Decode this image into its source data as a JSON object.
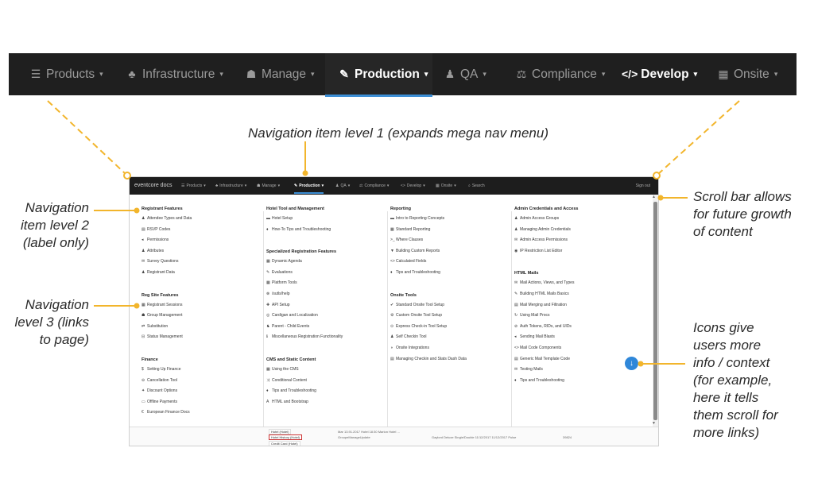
{
  "top_nav": {
    "items": [
      {
        "label": "Products",
        "icon": "list-icon",
        "glyph": "☰"
      },
      {
        "label": "Infrastructure",
        "icon": "sitemap-icon",
        "glyph": "♣"
      },
      {
        "label": "Manage",
        "icon": "users-icon",
        "glyph": "☗"
      },
      {
        "label": "Production",
        "icon": "edit-icon",
        "glyph": "✎"
      },
      {
        "label": "QA",
        "icon": "user-md-icon",
        "glyph": "♟"
      },
      {
        "label": "Compliance",
        "icon": "gavel-icon",
        "glyph": "⚖"
      },
      {
        "label": "Develop",
        "icon": "code-icon",
        "glyph": "</>"
      },
      {
        "label": "Onsite",
        "icon": "building-icon",
        "glyph": "▦"
      }
    ],
    "caret": "▾"
  },
  "mini_nav": {
    "brand": "eventcore docs",
    "items": [
      {
        "label": "Products",
        "glyph": "☰"
      },
      {
        "label": "Infrastructure",
        "glyph": "♣"
      },
      {
        "label": "Manage",
        "glyph": "☗"
      },
      {
        "label": "Production",
        "glyph": "✎"
      },
      {
        "label": "QA",
        "glyph": "♟"
      },
      {
        "label": "Compliance",
        "glyph": "⚖"
      },
      {
        "label": "Develop",
        "glyph": "<>"
      },
      {
        "label": "Onsite",
        "glyph": "▦"
      },
      {
        "label": "Search",
        "glyph": "⌕"
      }
    ],
    "caret": "▾",
    "sign_out": "Sign out"
  },
  "mega_menu": {
    "columns": [
      {
        "sections": [
          {
            "title": "Registrant Features",
            "links": [
              {
                "g": "♟",
                "t": "Attendee Types and Data"
              },
              {
                "g": "▤",
                "t": "RSVP Codes"
              },
              {
                "g": "◂",
                "t": "Permissions"
              },
              {
                "g": "♟",
                "t": "Attributes"
              },
              {
                "g": "✉",
                "t": "Survey Questions"
              },
              {
                "g": "♟",
                "t": "Registrant Data"
              }
            ]
          },
          {
            "title": "Reg Site Features",
            "links": [
              {
                "g": "▦",
                "t": "Registrant Sessions"
              },
              {
                "g": "☗",
                "t": "Group Management"
              },
              {
                "g": "⇄",
                "t": "Substitution"
              },
              {
                "g": "⊟",
                "t": "Status Management"
              }
            ]
          },
          {
            "title": "Finance",
            "links": [
              {
                "g": "$",
                "t": "Setting Up Finance"
              },
              {
                "g": "⊖",
                "t": "Cancellation Tool"
              },
              {
                "g": "✦",
                "t": "Discount Options"
              },
              {
                "g": "▭",
                "t": "Offline Payments"
              },
              {
                "g": "€",
                "t": "European Finance Docs"
              }
            ]
          }
        ]
      },
      {
        "sections": [
          {
            "title": "Hotel Tool and Management",
            "links": [
              {
                "g": "▬",
                "t": "Hotel Setup"
              },
              {
                "g": "♦",
                "t": "How-To Tips and Troubleshooting"
              }
            ]
          },
          {
            "title": "Specialized Registration Features",
            "links": [
              {
                "g": "▦",
                "t": "Dynamic Agenda"
              },
              {
                "g": "✎",
                "t": "Evaluations"
              },
              {
                "g": "▦",
                "t": "Platform Tools"
              },
              {
                "g": "⊗",
                "t": "/sutls/help"
              },
              {
                "g": "✚",
                "t": "API Setup"
              },
              {
                "g": "◎",
                "t": "Cardigan and Localization"
              },
              {
                "g": "♞",
                "t": "Parent - Child Events"
              },
              {
                "g": "ℹ",
                "t": "Miscellaneous Registration Functionality"
              }
            ]
          },
          {
            "title": "CMS and Static Content",
            "links": [
              {
                "g": "▦",
                "t": "Using the CMS"
              },
              {
                "g": "⤨",
                "t": "Conditional Content"
              },
              {
                "g": "♦",
                "t": "Tips and Troubleshooting"
              },
              {
                "g": "A",
                "t": "HTML and Bootstrap"
              }
            ]
          }
        ]
      },
      {
        "sections": [
          {
            "title": "Reporting",
            "links": [
              {
                "g": "▬",
                "t": "Intro to Reporting Concepts"
              },
              {
                "g": "▦",
                "t": "Standard Reporting"
              },
              {
                "g": ">_",
                "t": "Where Clauses"
              },
              {
                "g": "▼",
                "t": "Building Custom Reports"
              },
              {
                "g": "<>",
                "t": "Calculated Fields"
              },
              {
                "g": "♦",
                "t": "Tips and Troubleshooting"
              }
            ]
          },
          {
            "title": "Onsite Tools",
            "links": [
              {
                "g": "✔",
                "t": "Standard Onsite Tool Setup"
              },
              {
                "g": "⚙",
                "t": "Custom Onsite Tool Setup"
              },
              {
                "g": "⊙",
                "t": "Express Check-in Tool Setup"
              },
              {
                "g": "♟",
                "t": "Self Checkin Tool"
              },
              {
                "g": "◑",
                "t": "Onsite Integrations"
              },
              {
                "g": "▤",
                "t": "Managing Checkin and Stats Dash Data"
              }
            ]
          }
        ]
      },
      {
        "sections": [
          {
            "title": "Admin Credentials and Access",
            "links": [
              {
                "g": "♟",
                "t": "Admin Access Groups"
              },
              {
                "g": "♟",
                "t": "Managing Admin Credentials"
              },
              {
                "g": "✉",
                "t": "Admin Access Permissions"
              },
              {
                "g": "◉",
                "t": "IP Restriction List Editor"
              }
            ]
          },
          {
            "title": "HTML Mails",
            "links": [
              {
                "g": "✉",
                "t": "Mail Actions, Views, and Types"
              },
              {
                "g": "✎",
                "t": "Building HTML Mails Basics"
              },
              {
                "g": "▤",
                "t": "Mail Merging and Filtration"
              },
              {
                "g": "↻",
                "t": "Using Mail Procs"
              },
              {
                "g": "⊘",
                "t": "Auth Tokens, RIDs, and UIDs"
              },
              {
                "g": "◂",
                "t": "Sending Mail Blasts"
              },
              {
                "g": "<>",
                "t": "Mail Code Components"
              },
              {
                "g": "▤",
                "t": "Generic Mail Template Code"
              },
              {
                "g": "✉",
                "t": "Testing Mails"
              },
              {
                "g": "♦",
                "t": "Tips and Troubleshooting"
              }
            ]
          }
        ]
      }
    ],
    "scroll_button_glyph": "↓"
  },
  "background_page": {
    "rows": [
      "Hotel (Hotel)",
      "Hotel History (Hotel)",
      "Credit Card (Hotel)"
    ],
    "cell_texts": [
      "GroupeManageUpdate",
      "Mar  13.91.2017 Hotel  18:30  Marion  Hotel ...",
      "Gaylord  Deluxe  Single/Double  11/12/2017  11/12/2017  Pulse",
      "39824"
    ]
  },
  "annotations": {
    "level1": "Navigation item level 1 (expands mega nav menu)",
    "level2": [
      "Navigation",
      "item level 2",
      "(label only)"
    ],
    "level3": [
      "Navigation",
      "level 3 (links",
      "to page)"
    ],
    "scrollbar": [
      "Scroll bar allows",
      "for future growth",
      "of content"
    ],
    "icons": [
      "Icons give",
      "users more",
      "info / context",
      "(for example,",
      "here it tells",
      "them scroll for",
      "more links)"
    ]
  },
  "colors": {
    "nav_bg": "#1f1f1f",
    "active_underline": "#3d8fd6",
    "annotation_line": "#f2b52c",
    "scroll_button": "#2f87d9"
  }
}
